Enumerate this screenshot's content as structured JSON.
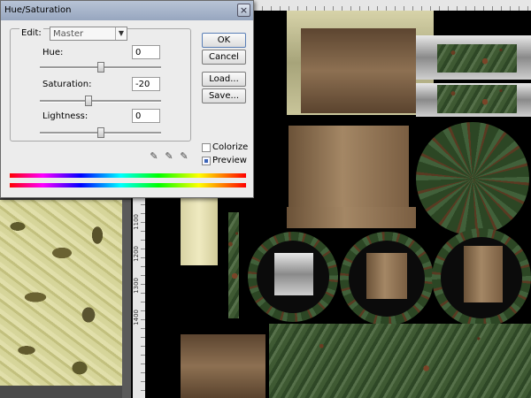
{
  "dialog": {
    "title": "Hue/Saturation",
    "close_glyph": "×",
    "edit_label": "Edit:",
    "edit_value": "Master",
    "hue": {
      "label": "Hue:",
      "value": "0",
      "slider_level": 0.5
    },
    "saturation": {
      "label": "Saturation:",
      "value": "-20",
      "slider_level": 0.4
    },
    "lightness": {
      "label": "Lightness:",
      "value": "0",
      "slider_level": 0.5
    },
    "buttons": {
      "ok": "OK",
      "cancel": "Cancel",
      "load": "Load...",
      "save": "Save..."
    },
    "colorize": {
      "label": "Colorize",
      "checked": false
    },
    "preview": {
      "label": "Preview",
      "checked": true
    },
    "droppers": [
      "eyedropper-icon",
      "eyedropper-plus-icon",
      "eyedropper-minus-icon"
    ]
  },
  "rulers": {
    "left_marks": [
      "1100",
      "1200",
      "1300",
      "1400"
    ]
  },
  "colors": {
    "dialog_bg": "#ececec",
    "titlebar": "#a8b6cc",
    "canvas_bg": "#000000",
    "rust_green": "#3f5a33",
    "brown": "#a48765"
  }
}
